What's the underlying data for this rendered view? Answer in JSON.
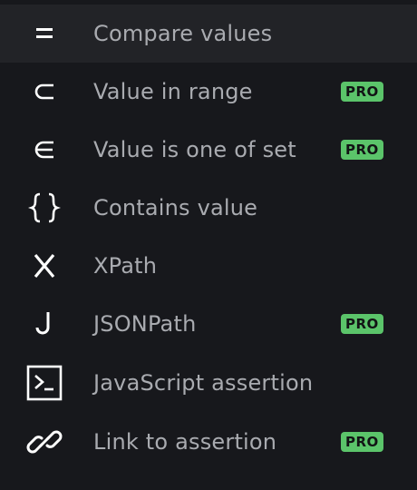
{
  "menu": {
    "items": [
      {
        "label": "Compare values",
        "icon": "equals-icon",
        "glyph": "=",
        "pro": false,
        "active": true
      },
      {
        "label": "Value in range",
        "icon": "subset-icon",
        "glyph": "⊂",
        "pro": true,
        "active": false
      },
      {
        "label": "Value is one of set",
        "icon": "element-of-icon",
        "glyph": "∈",
        "pro": true,
        "active": false
      },
      {
        "label": "Contains value",
        "icon": "braces-icon",
        "glyph": "{}",
        "pro": false,
        "active": false
      },
      {
        "label": "XPath",
        "icon": "x-icon",
        "glyph": "X",
        "pro": false,
        "active": false
      },
      {
        "label": "JSONPath",
        "icon": "j-icon",
        "glyph": "J",
        "pro": true,
        "active": false
      },
      {
        "label": "JavaScript assertion",
        "icon": "terminal-icon",
        "glyph": ">_",
        "pro": false,
        "active": false
      },
      {
        "label": "Link to assertion",
        "icon": "link-icon",
        "glyph": "link",
        "pro": true,
        "active": false
      }
    ],
    "badge_label": "PRO"
  },
  "colors": {
    "background": "#17181c",
    "active_row": "#222327",
    "label": "#a9abb0",
    "icon": "#ffffff",
    "badge_bg": "#5bc46a",
    "badge_text": "#121315"
  }
}
